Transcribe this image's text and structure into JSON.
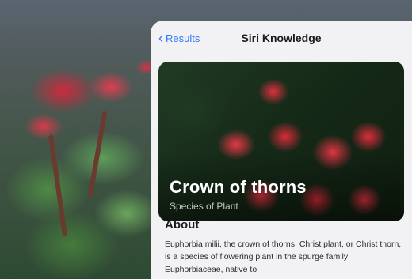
{
  "sheet": {
    "back_label": "Results",
    "title": "Siri Knowledge"
  },
  "hero": {
    "title": "Crown of thorns",
    "subtitle": "Species of Plant"
  },
  "about": {
    "heading": "About",
    "body": "Euphorbia milii, the crown of thorns, Christ plant, or Christ thorn, is a species of flowering plant in the spurge family Euphorbiaceae, native to"
  },
  "colors": {
    "accent": "#3478f6",
    "sheet_background": "#f2f2f4"
  },
  "icons": {
    "back": "chevron-left-icon"
  }
}
